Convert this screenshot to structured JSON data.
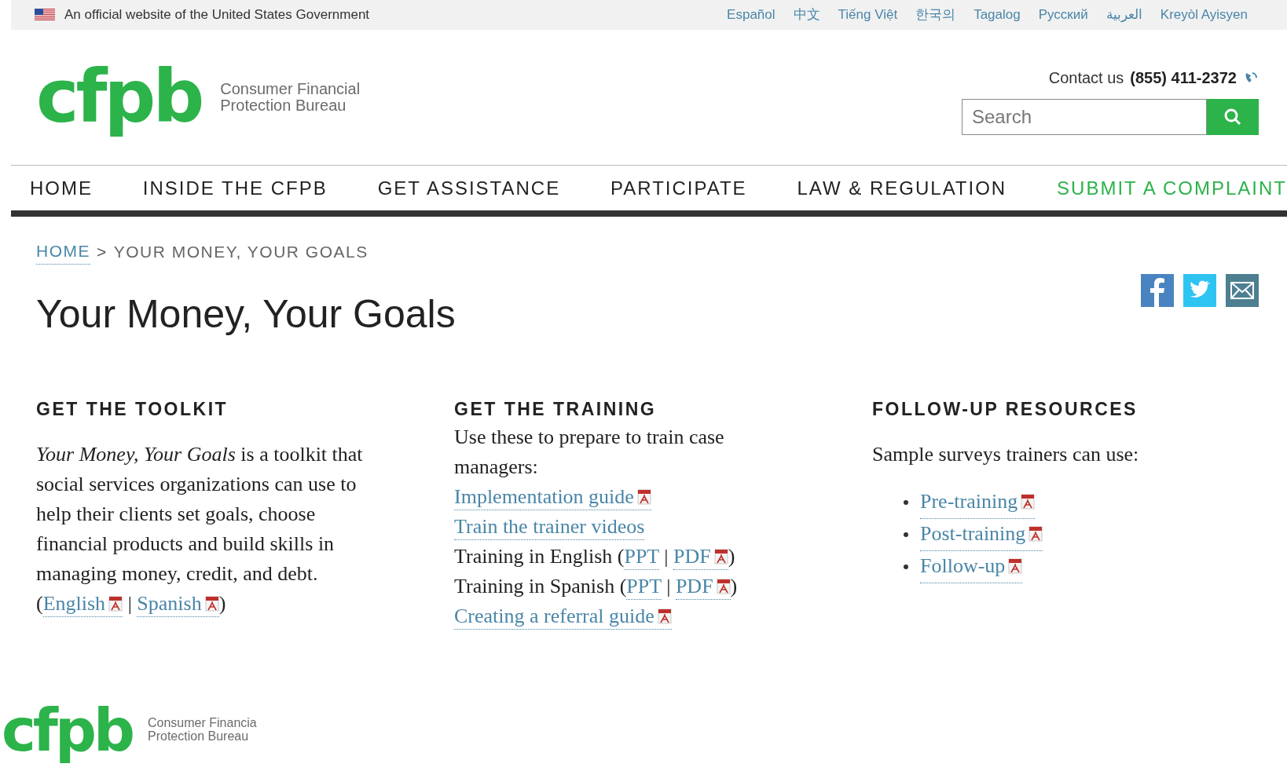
{
  "gov_banner": {
    "text": "An official website of the United States Government",
    "languages": [
      "Español",
      "中文",
      "Tiếng Việt",
      "한국의",
      "Tagalog",
      "Русский",
      "العربية",
      "Kreyòl Ayisyen"
    ]
  },
  "header": {
    "logo": {
      "mark": "cfpb",
      "name_lines": [
        "Consumer Financial",
        "Protection Bureau"
      ]
    },
    "contact": {
      "label": "Contact us",
      "phone": "(855) 411-2372"
    },
    "search": {
      "placeholder": "Search"
    }
  },
  "nav": [
    {
      "label": "HOME",
      "kind": "normal"
    },
    {
      "label": "INSIDE THE CFPB",
      "kind": "normal"
    },
    {
      "label": "GET ASSISTANCE",
      "kind": "normal"
    },
    {
      "label": "PARTICIPATE",
      "kind": "normal"
    },
    {
      "label": "LAW & REGULATION",
      "kind": "normal"
    },
    {
      "label": "SUBMIT A COMPLAINT",
      "kind": "highlight"
    }
  ],
  "breadcrumb": {
    "items": [
      {
        "label": "HOME",
        "kind": "link"
      },
      {
        "label": "YOUR MONEY, YOUR GOALS",
        "kind": "current"
      }
    ],
    "separator": ">"
  },
  "title": "Your Money, Your Goals",
  "columns": [
    {
      "heading": "GET THE TOOLKIT",
      "intro": "*Your Money, Your Goals* is a toolkit that social services organizations can use to help their clients set goals, choose financial products and build skills in managing money, credit, and debt.",
      "lines": [
        [
          {
            "kind": "text",
            "text": "("
          },
          {
            "kind": "link",
            "text": "English",
            "pdf": true
          },
          {
            "kind": "text",
            "text": " | "
          },
          {
            "kind": "link",
            "text": "Spanish",
            "pdf": true
          },
          {
            "kind": "text",
            "text": ")"
          }
        ]
      ]
    },
    {
      "heading": "GET THE TRAINING",
      "intro": "Use these to prepare to train case managers:",
      "lines": [
        [
          {
            "kind": "link",
            "text": "Implementation guide",
            "pdf": true
          }
        ],
        [
          {
            "kind": "link",
            "text": "Train the trainer videos",
            "pdf": false
          }
        ],
        [
          {
            "kind": "text",
            "text": "Training in English ("
          },
          {
            "kind": "link",
            "text": "PPT",
            "pdf": false
          },
          {
            "kind": "text",
            "text": " | "
          },
          {
            "kind": "link",
            "text": "PDF",
            "pdf": true
          },
          {
            "kind": "text",
            "text": ")"
          }
        ],
        [
          {
            "kind": "text",
            "text": "Training in Spanish ("
          },
          {
            "kind": "link",
            "text": "PPT",
            "pdf": false
          },
          {
            "kind": "text",
            "text": " | "
          },
          {
            "kind": "link",
            "text": "PDF",
            "pdf": true
          },
          {
            "kind": "text",
            "text": ")"
          }
        ],
        [
          {
            "kind": "link",
            "text": "Creating a referral guide",
            "pdf": true
          }
        ]
      ]
    },
    {
      "heading": "FOLLOW-UP RESOURCES",
      "intro": "Sample surveys trainers can use:",
      "bullets": [
        {
          "text": "Pre-training",
          "pdf": true
        },
        {
          "text": "Post-training",
          "pdf": true
        },
        {
          "text": "Follow-up",
          "pdf": true
        }
      ]
    }
  ],
  "footer": {
    "logo": {
      "mark": "cfpb",
      "name_lines": [
        "Consumer Financia",
        "Protection Bureau"
      ]
    }
  }
}
